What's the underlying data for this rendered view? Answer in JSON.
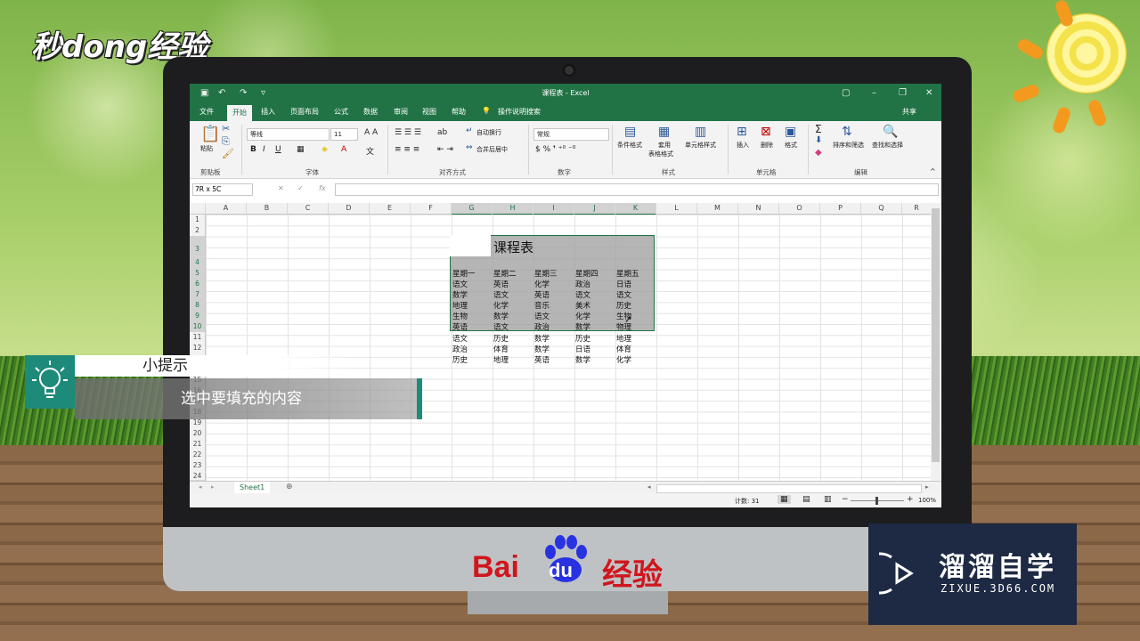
{
  "brand": {
    "top_logo": "秒dong经验",
    "baidu_bai": "Bai",
    "baidu_du": "du",
    "baidu_jingyan": "经验",
    "watermark_title": "溜溜自学",
    "watermark_url": "ZIXUE.3D66.COM"
  },
  "excel": {
    "window_title": "课程表 - Excel",
    "tabs": [
      "文件",
      "开始",
      "插入",
      "页面布局",
      "公式",
      "数据",
      "审阅",
      "视图",
      "帮助"
    ],
    "active_tab": "开始",
    "tell_me": "操作说明搜索",
    "share": "共享",
    "ribbon": {
      "paste": "粘贴",
      "clipboard": "剪贴板",
      "font_name": "等线",
      "font_size": "11",
      "font_group": "字体",
      "wrap_text": "自动换行",
      "merge_center": "合并后居中",
      "alignment_group": "对齐方式",
      "number_format": "常规",
      "number_group": "数字",
      "cond_format": "条件格式",
      "table_format_1": "套用",
      "table_format_2": "表格格式",
      "cell_styles": "单元格样式",
      "styles_group": "样式",
      "insert": "插入",
      "delete": "删除",
      "format": "格式",
      "cells_group": "单元格",
      "sort_filter": "排序和筛选",
      "find_select": "查找和选择",
      "editing_group": "编辑"
    },
    "name_box": "7R x 5C",
    "fx": "fx",
    "columns": [
      "A",
      "B",
      "C",
      "D",
      "E",
      "F",
      "G",
      "H",
      "I",
      "J",
      "K",
      "L",
      "M",
      "N",
      "O",
      "P",
      "Q",
      "R"
    ],
    "rows": [
      "1",
      "2",
      "3",
      "4",
      "5",
      "6",
      "7",
      "8",
      "9",
      "10",
      "11",
      "12",
      "13",
      "14",
      "15",
      "16",
      "17",
      "18",
      "19",
      "20",
      "21",
      "22",
      "23",
      "24"
    ],
    "sheet_title": "课程表",
    "table": [
      [
        "星期一",
        "星期二",
        "星期三",
        "星期四",
        "星期五"
      ],
      [
        "语文",
        "英语",
        "化学",
        "政治",
        "日语"
      ],
      [
        "数学",
        "语文",
        "英语",
        "语文",
        "语文"
      ],
      [
        "地理",
        "化学",
        "音乐",
        "美术",
        "历史"
      ],
      [
        "生物",
        "数学",
        "语文",
        "化学",
        "生物"
      ],
      [
        "英语",
        "语文",
        "政治",
        "数学",
        "物理"
      ],
      [
        "语文",
        "历史",
        "数学",
        "历史",
        "地理"
      ],
      [
        "政治",
        "体育",
        "数学",
        "日语",
        "体育"
      ],
      [
        "历史",
        "地理",
        "英语",
        "数学",
        "化学"
      ]
    ],
    "sheet_tab": "Sheet1",
    "status_count": "计数: 31",
    "zoom": "100%"
  },
  "tip": {
    "heading": "小提示",
    "body": "选中要填充的内容"
  }
}
